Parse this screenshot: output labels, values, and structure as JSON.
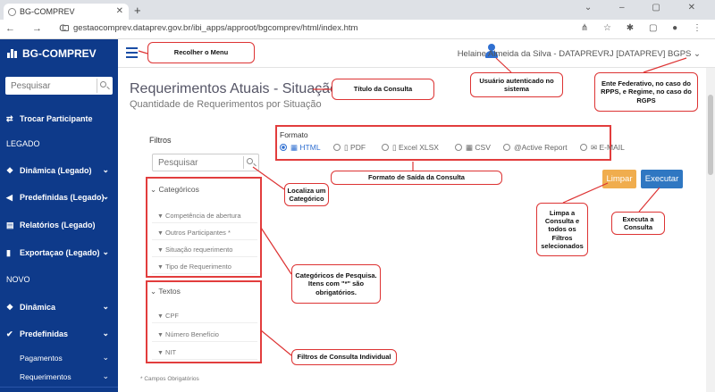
{
  "browser": {
    "tab_title": "BG-COMPREV",
    "url": "gestaocomprev.dataprev.gov.br/ibi_apps/approot/bgcomprev/html/index.htm"
  },
  "app": {
    "brand": "BG-COMPREV",
    "user": "Helaine Almeida da Silva - DATAPREVRJ [DATAPREV] BGPS"
  },
  "sidebar": {
    "search_placeholder": "Pesquisar",
    "items": [
      {
        "label": "Trocar Participante",
        "icon": "swap-icon"
      },
      {
        "label": "LEGADO",
        "icon": ""
      },
      {
        "label": "Dinâmica (Legado)",
        "icon": "cubes-icon"
      },
      {
        "label": "Predefinidas (Legado)",
        "icon": "caret-left-icon"
      },
      {
        "label": "Relatórios (Legado)",
        "icon": "file-icon"
      },
      {
        "label": "Exportaçao (Legado)",
        "icon": "document-icon"
      },
      {
        "label": "NOVO",
        "icon": ""
      },
      {
        "label": "Dinâmica",
        "icon": "cubes-icon"
      },
      {
        "label": "Predefinidas",
        "icon": "check-icon"
      }
    ],
    "subitems": [
      {
        "label": "Pagamentos"
      },
      {
        "label": "Requerimentos"
      }
    ]
  },
  "main": {
    "title": "Requerimentos Atuais - Situação",
    "subtitle": "Quantidade de Requerimentos por Situação",
    "filters": {
      "label": "Filtros",
      "search_placeholder": "Pesquisar",
      "categoricos": {
        "title": "Categóricos",
        "items": [
          "Competência de abertura",
          "Outros Participantes *",
          "Situação requerimento",
          "Tipo de Requerimento"
        ]
      },
      "textos": {
        "title": "Textos",
        "items": [
          "CPF",
          "Número Benefício",
          "NIT"
        ]
      }
    },
    "formato": {
      "label": "Formato",
      "options": [
        "HTML",
        "PDF",
        "Excel XLSX",
        "CSV",
        "@Active Report",
        "E-MAIL"
      ],
      "selected": "HTML"
    },
    "buttons": {
      "limpar": "Limpar",
      "executar": "Executar"
    },
    "footnote": "* Campos Obrigatórios"
  },
  "callouts": {
    "recolher": "Recolher o Menu",
    "titulo": "Título da Consulta",
    "usuario": "Usuário autenticado no sistema",
    "ente": "Ente Federativo, no caso do RPPS, e Regime, no caso do RGPS",
    "localiza": "Localiza um Categórico",
    "formato_saida": "Formato de Saída da Consulta",
    "limpa": "Limpa a Consulta e todos os Filtros selecionados",
    "executa": "Executa a Consulta",
    "categoricos": "Categóricos de Pesquisa. Itens com \"*\" são obrigatórios.",
    "filtros_individuais": "Filtros de Consulta Individual"
  },
  "colors": {
    "sidebar": "#0e3a8a",
    "callout_border": "#d33",
    "limpar": "#f0ad4e",
    "executar": "#2f77c2"
  }
}
